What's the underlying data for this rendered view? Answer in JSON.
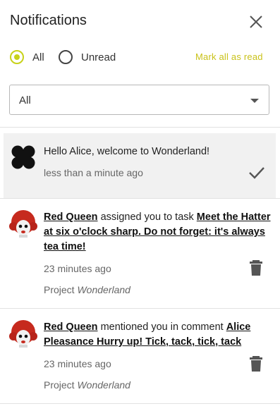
{
  "header": {
    "title": "Notifications"
  },
  "filters": {
    "options": [
      "All",
      "Unread"
    ],
    "selected": "All",
    "mark_all": "Mark all as read"
  },
  "select": {
    "value": "All"
  },
  "notifications": [
    {
      "text": "Hello Alice, welcome to Wonderland!",
      "time": "less than a minute ago",
      "read": true,
      "action_icon": "checkmark-icon"
    },
    {
      "actor": "Red Queen",
      "verb": " assigned you to task ",
      "target": "Meet the Hatter at six o'clock sharp. Do not forget: it's always tea time!",
      "time": "23 minutes ago",
      "project_label": "Project",
      "project_name": "Wonderland",
      "action_icon": "trash-icon"
    },
    {
      "actor": "Red Queen",
      "verb": " mentioned you in comment ",
      "target": "Alice Pleasance Hurry up! Tick, tack, tick, tack",
      "time": "23 minutes ago",
      "project_label": "Project",
      "project_name": "Wonderland",
      "action_icon": "trash-icon"
    }
  ],
  "colors": {
    "accent": "#c8d21a",
    "mark_all_link": "#c9c21a",
    "read_bg": "#f1f1f1"
  }
}
